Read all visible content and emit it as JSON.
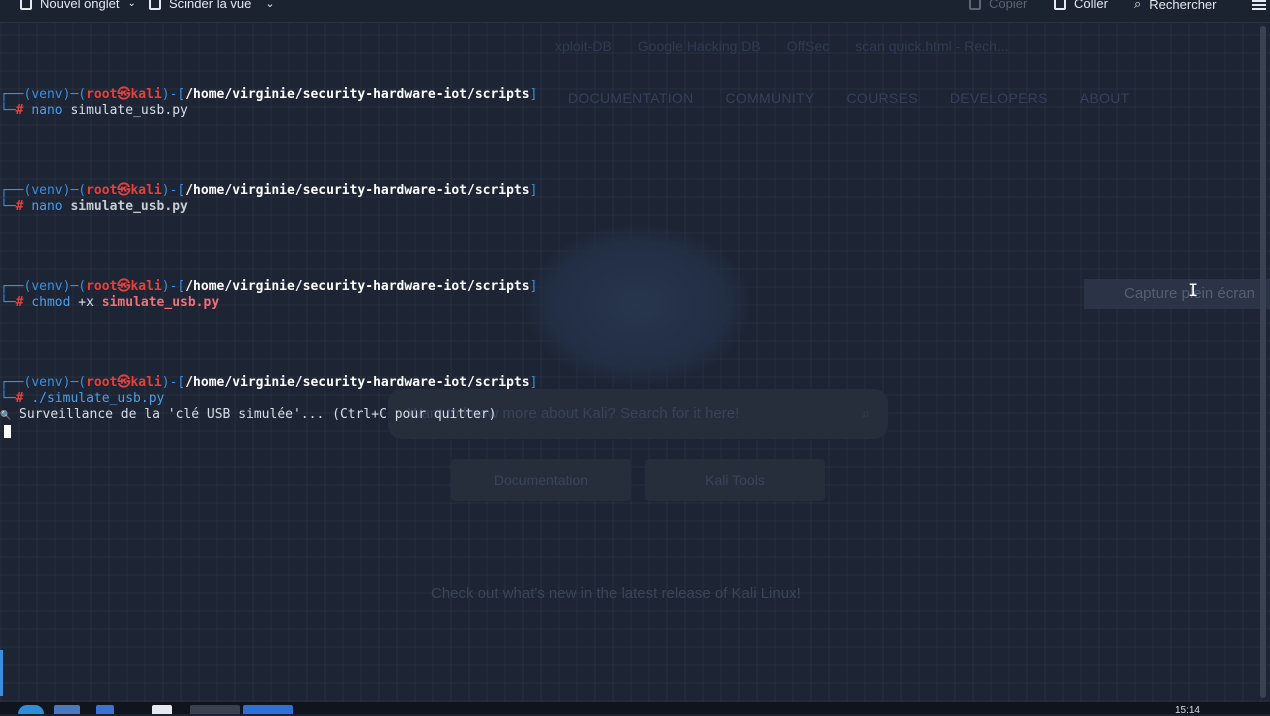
{
  "toolbar": {
    "new_tab": "Nouvel onglet",
    "split_view": "Scinder la vue",
    "copy": "Copier",
    "paste": "Coller",
    "search": "Rechercher"
  },
  "background": {
    "bookmarks": [
      "xploit-DB",
      "Google Hacking DB",
      "OffSec",
      "scan quick.html - Rech..."
    ],
    "nav": [
      "DOCUMENTATION",
      "COMMUNITY",
      "COURSES",
      "DEVELOPERS",
      "ABOUT"
    ],
    "search_placeholder": "Want to know more about Kali? Search for it here!",
    "buttons": [
      "Documentation",
      "Kali Tools"
    ],
    "news": "Check out what's new in the latest release of Kali Linux!",
    "capture": "Capture plein écran"
  },
  "terminal": {
    "prompt": {
      "open": "┌──(",
      "venv": "venv",
      "mid": ")─(",
      "user": "root",
      "at": "㉿",
      "host": "kali",
      "close": ")-[",
      "path": "/home/virginie/security-hardware-iot/scripts",
      "end": "]",
      "second": "└─",
      "hash": "#"
    },
    "commands": [
      {
        "cmd": "nano",
        "args": "",
        "file": "simulate_usb.py",
        "style": "plain"
      },
      {
        "cmd": "nano",
        "args": "",
        "file": "simulate_usb.py",
        "style": "grey"
      },
      {
        "cmd": "chmod",
        "args": "+x",
        "file": "simulate_usb.py",
        "style": "red"
      },
      {
        "cmd": "./simulate_usb.py",
        "args": "",
        "file": "",
        "style": "plain"
      }
    ],
    "output_icon": "🔍",
    "output": "Surveillance de la 'clé USB simulée'... (Ctrl+C pour quitter)"
  },
  "taskbar": {
    "clock": "15:14"
  }
}
